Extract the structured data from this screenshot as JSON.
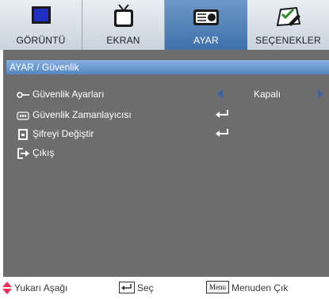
{
  "tabs": [
    {
      "label": "GÖRÜNTÜ",
      "icon": "monitor-icon",
      "active": false
    },
    {
      "label": "EKRAN",
      "icon": "tv-icon",
      "active": false
    },
    {
      "label": "AYAR",
      "icon": "projector-icon",
      "active": true
    },
    {
      "label": "SEÇENEKLER",
      "icon": "options-icon",
      "active": false
    }
  ],
  "section": {
    "title": "AYAR / Güvenlik"
  },
  "rows": [
    {
      "label": "Güvenlik Ayarları",
      "icon": "key-icon",
      "value": "Kapalı"
    },
    {
      "label": "Güvenlik Zamanlayıcısı",
      "icon": "timer-icon",
      "action": "enter-icon"
    },
    {
      "label": "Şifreyi Değiştir",
      "icon": "lock-icon",
      "action": "enter-icon"
    },
    {
      "label": "Çıkış",
      "icon": "exit-icon"
    }
  ],
  "footer": {
    "nav": "Yukarı Aşağı",
    "select": "Seç",
    "menu_key": "Menu",
    "exit": "Menuden Çık"
  },
  "colors": {
    "active_tab": "#4f80bb",
    "panel": "#6d6d6d",
    "header": "#6a9bd2",
    "accent_arrow": "#e8305a"
  }
}
